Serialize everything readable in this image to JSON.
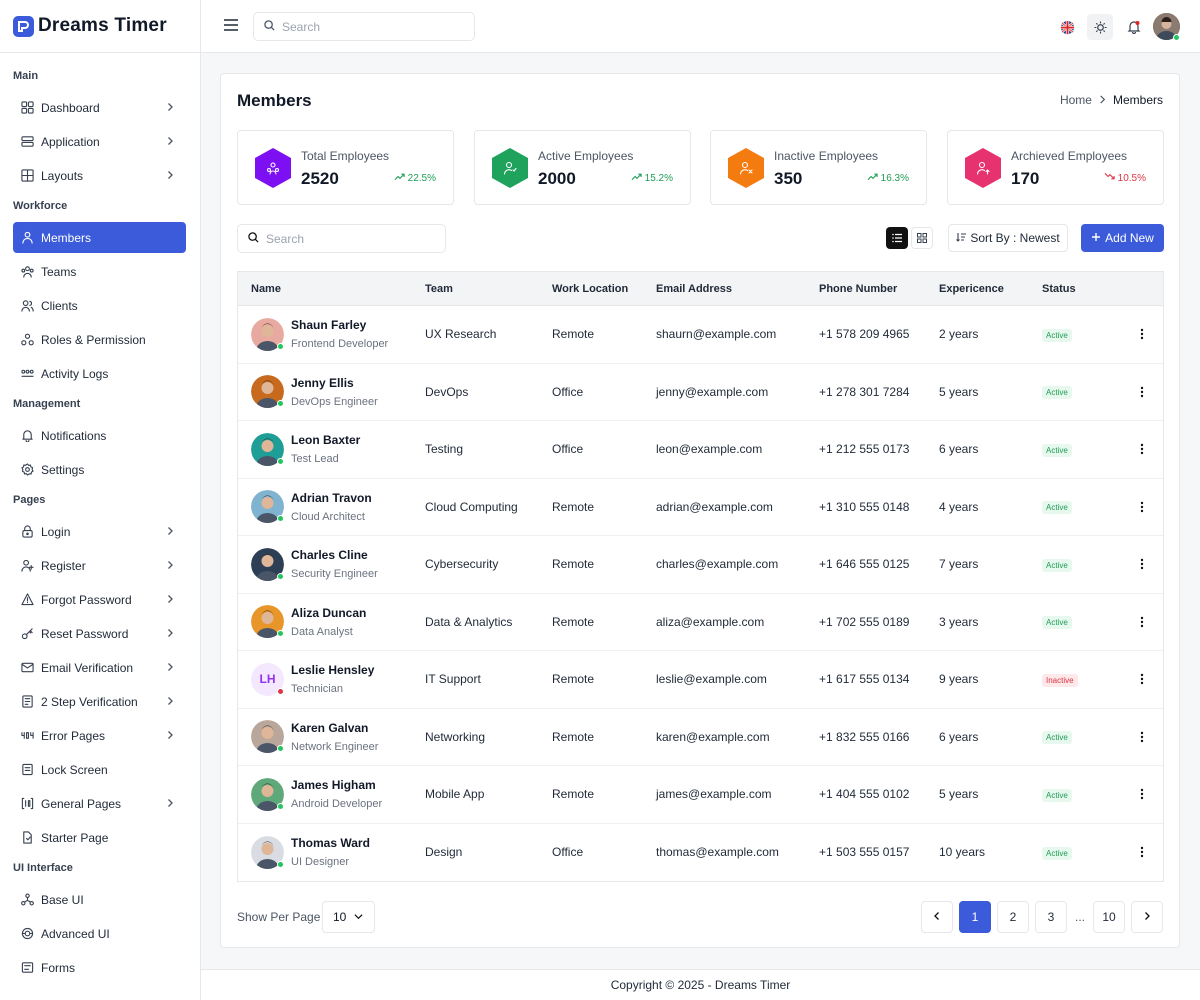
{
  "app": {
    "name": "Dreams Timer"
  },
  "sidebar": {
    "sections": [
      {
        "title": "Main",
        "items": [
          {
            "label": "Dashboard",
            "icon": "dashboard-icon",
            "chevron": true
          },
          {
            "label": "Application",
            "icon": "application-icon",
            "chevron": true
          },
          {
            "label": "Layouts",
            "icon": "layouts-icon",
            "chevron": true
          }
        ]
      },
      {
        "title": "Workforce",
        "items": [
          {
            "label": "Members",
            "icon": "members-icon",
            "chevron": false,
            "active": true
          },
          {
            "label": "Teams",
            "icon": "teams-icon",
            "chevron": false
          },
          {
            "label": "Clients",
            "icon": "clients-icon",
            "chevron": false
          },
          {
            "label": "Roles & Permission",
            "icon": "roles-icon",
            "chevron": false
          },
          {
            "label": "Activity Logs",
            "icon": "activity-icon",
            "chevron": false
          }
        ]
      },
      {
        "title": "Management",
        "items": [
          {
            "label": "Notifications",
            "icon": "bell-icon",
            "chevron": false
          },
          {
            "label": "Settings",
            "icon": "gear-icon",
            "chevron": false
          }
        ]
      },
      {
        "title": "Pages",
        "items": [
          {
            "label": "Login",
            "icon": "lock-icon",
            "chevron": true
          },
          {
            "label": "Register",
            "icon": "user-plus-icon",
            "chevron": true
          },
          {
            "label": "Forgot Password",
            "icon": "warning-icon",
            "chevron": true
          },
          {
            "label": "Reset Password",
            "icon": "key-icon",
            "chevron": true
          },
          {
            "label": "Email Verification",
            "icon": "mail-icon",
            "chevron": true
          },
          {
            "label": "2 Step Verification",
            "icon": "shield-icon",
            "chevron": true
          },
          {
            "label": "Error Pages",
            "icon": "error-404-icon",
            "chevron": true
          },
          {
            "label": "Lock Screen",
            "icon": "lock-screen-icon",
            "chevron": false
          },
          {
            "label": "General Pages",
            "icon": "pages-icon",
            "chevron": true
          },
          {
            "label": "Starter Page",
            "icon": "file-icon",
            "chevron": false
          }
        ]
      },
      {
        "title": "UI Interface",
        "items": [
          {
            "label": "Base UI",
            "icon": "hierarchy-icon",
            "chevron": false
          },
          {
            "label": "Advanced UI",
            "icon": "badge-icon",
            "chevron": false
          },
          {
            "label": "Forms",
            "icon": "forms-icon",
            "chevron": false
          }
        ]
      }
    ]
  },
  "topbar": {
    "search_placeholder": "Search",
    "icons": [
      "hamburger-icon",
      "flag-uk-icon",
      "sun-icon",
      "bell-icon"
    ]
  },
  "page": {
    "title": "Members",
    "breadcrumb": {
      "home": "Home",
      "current": "Members"
    }
  },
  "stats": [
    {
      "label": "Total Employees",
      "value": "2520",
      "trend": "22.5%",
      "direction": "up",
      "color": "#7c10f2"
    },
    {
      "label": "Active Employees",
      "value": "2000",
      "trend": "15.2%",
      "direction": "up",
      "color": "#1fa35c"
    },
    {
      "label": "Inactive Employees",
      "value": "350",
      "trend": "16.3%",
      "direction": "up",
      "color": "#f47b0f"
    },
    {
      "label": "Archieved Employees",
      "value": "170",
      "trend": "10.5%",
      "direction": "down",
      "color": "#e6336f"
    }
  ],
  "toolbar": {
    "search_placeholder": "Search",
    "sort_label": "Sort By : Newest",
    "add_label": "Add New"
  },
  "table": {
    "headers": [
      "Name",
      "Team",
      "Work Location",
      "Email Address",
      "Phone Number",
      "Expericence",
      "Status"
    ],
    "rows": [
      {
        "name": "Shaun Farley",
        "role": "Frontend Developer",
        "team": "UX Research",
        "location": "Remote",
        "email": "shaurn@example.com",
        "phone": "+1 578 209 4965",
        "experience": "2 years",
        "status": "Active",
        "online": true,
        "avatar_color": "#e8a9a0"
      },
      {
        "name": "Jenny Ellis",
        "role": "DevOps Engineer",
        "team": "DevOps",
        "location": "Office",
        "email": "jenny@example.com",
        "phone": "+1 278 301 7284",
        "experience": "5 years",
        "status": "Active",
        "online": true,
        "avatar_color": "#c76a1e"
      },
      {
        "name": "Leon Baxter",
        "role": "Test Lead",
        "team": "Testing",
        "location": "Office",
        "email": "leon@example.com",
        "phone": "+1 212 555 0173",
        "experience": "6 years",
        "status": "Active",
        "online": true,
        "avatar_color": "#1e9e96"
      },
      {
        "name": "Adrian Travon",
        "role": "Cloud Architect",
        "team": "Cloud Computing",
        "location": "Remote",
        "email": "adrian@example.com",
        "phone": "+1 310 555 0148",
        "experience": "4 years",
        "status": "Active",
        "online": true,
        "avatar_color": "#7fb3cf"
      },
      {
        "name": "Charles Cline",
        "role": "Security Engineer",
        "team": "Cybersecurity",
        "location": "Remote",
        "email": "charles@example.com",
        "phone": "+1 646 555 0125",
        "experience": "7 years",
        "status": "Active",
        "online": true,
        "avatar_color": "#2d3f55"
      },
      {
        "name": "Aliza Duncan",
        "role": "Data Analyst",
        "team": "Data & Analytics",
        "location": "Remote",
        "email": "aliza@example.com",
        "phone": "+1 702 555 0189",
        "experience": "3 years",
        "status": "Active",
        "online": true,
        "avatar_color": "#e8952a"
      },
      {
        "name": "Leslie Hensley",
        "role": "Technician",
        "team": "IT Support",
        "location": "Remote",
        "email": "leslie@example.com",
        "phone": "+1 617 555 0134",
        "experience": "9 years",
        "status": "Inactive",
        "online": false,
        "initials": "LH",
        "avatar_color": "#f3e8fd"
      },
      {
        "name": "Karen Galvan",
        "role": "Network Engineer",
        "team": "Networking",
        "location": "Remote",
        "email": "karen@example.com",
        "phone": "+1 832 555 0166",
        "experience": "6 years",
        "status": "Active",
        "online": true,
        "avatar_color": "#b9a79b"
      },
      {
        "name": "James Higham",
        "role": "Android Developer",
        "team": "Mobile App",
        "location": "Remote",
        "email": "james@example.com",
        "phone": "+1 404 555 0102",
        "experience": "5 years",
        "status": "Active",
        "online": true,
        "avatar_color": "#5fa87a"
      },
      {
        "name": "Thomas Ward",
        "role": "UI Designer",
        "team": "Design",
        "location": "Office",
        "email": "thomas@example.com",
        "phone": "+1 503 555 0157",
        "experience": "10 years",
        "status": "Active",
        "online": true,
        "avatar_color": "#d9dde3"
      }
    ]
  },
  "pagination": {
    "per_page_label": "Show Per Page",
    "per_page": "10",
    "pages": [
      "1",
      "2",
      "3"
    ],
    "ellipsis": "...",
    "last": "10",
    "current": "1"
  },
  "footer": {
    "text": "Copyright © 2025 - Dreams Timer"
  }
}
